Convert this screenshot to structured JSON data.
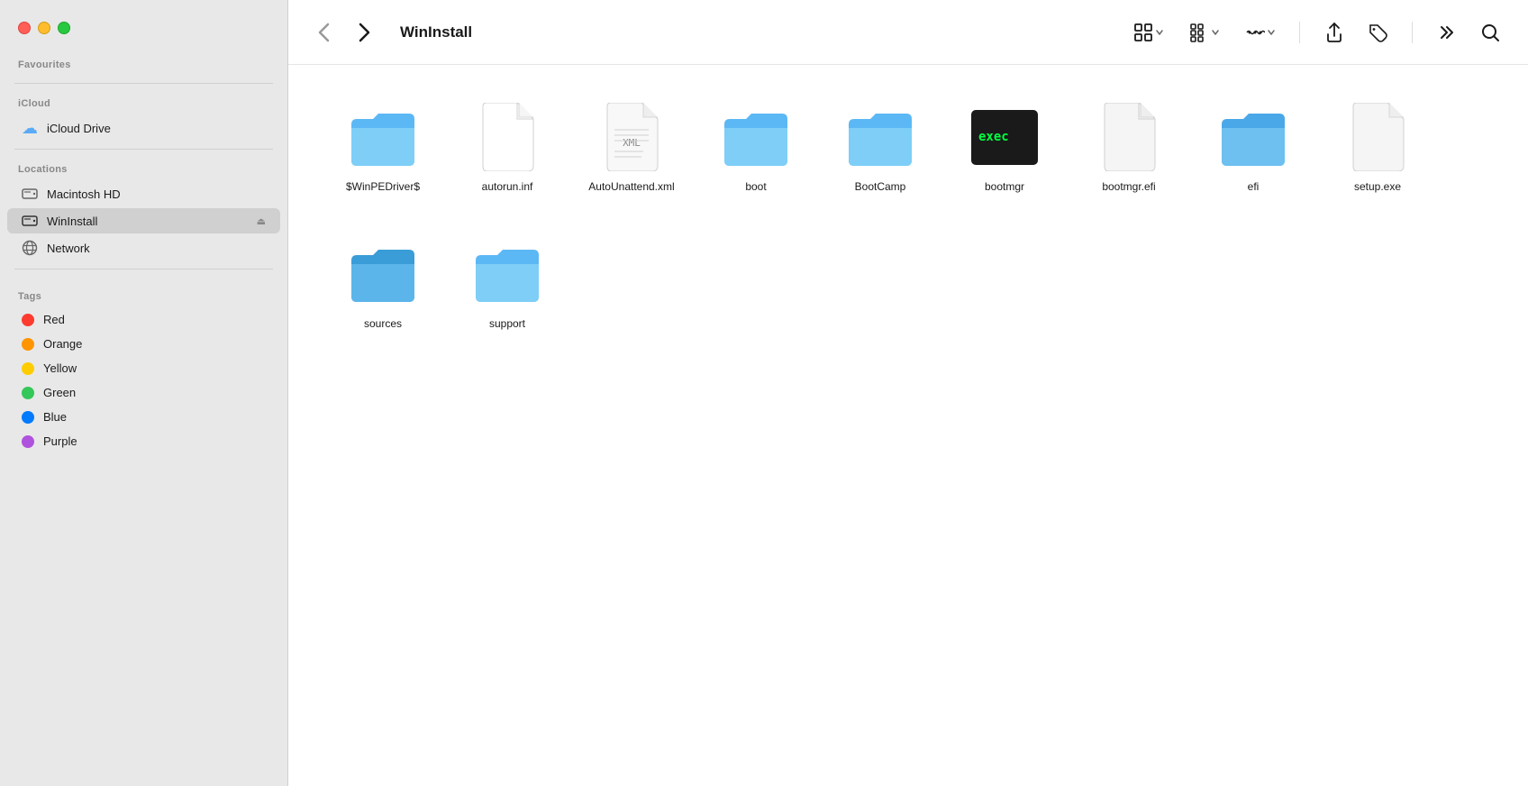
{
  "window": {
    "title": "WinInstall"
  },
  "sidebar": {
    "favourites_label": "Favourites",
    "icloud_label": "iCloud",
    "icloud_drive_label": "iCloud Drive",
    "locations_label": "Locations",
    "macintosh_hd_label": "Macintosh HD",
    "wininstall_label": "WinInstall",
    "network_label": "Network",
    "tags_label": "Tags",
    "tags": [
      {
        "name": "Red",
        "color": "#ff3b30"
      },
      {
        "name": "Orange",
        "color": "#ff9500"
      },
      {
        "name": "Yellow",
        "color": "#ffcc00"
      },
      {
        "name": "Green",
        "color": "#34c759"
      },
      {
        "name": "Blue",
        "color": "#007aff"
      },
      {
        "name": "Purple",
        "color": "#af52de"
      }
    ]
  },
  "toolbar": {
    "back_tooltip": "Back",
    "forward_tooltip": "Forward",
    "view_icon_label": "View options",
    "group_icon_label": "Group",
    "more_icon_label": "More options",
    "share_icon_label": "Share",
    "tag_icon_label": "Tag",
    "more_actions_label": "More actions",
    "search_label": "Search"
  },
  "files": [
    {
      "name": "$WinPEDriver$",
      "type": "folder"
    },
    {
      "name": "autorun.inf",
      "type": "inf"
    },
    {
      "name": "AutoUnattend.xml",
      "type": "xml"
    },
    {
      "name": "boot",
      "type": "folder"
    },
    {
      "name": "BootCamp",
      "type": "folder"
    },
    {
      "name": "bootmgr",
      "type": "exec"
    },
    {
      "name": "bootmgr.efi",
      "type": "efi"
    },
    {
      "name": "efi",
      "type": "folder-open"
    },
    {
      "name": "setup.exe",
      "type": "setup"
    },
    {
      "name": "sources",
      "type": "folder-dark"
    },
    {
      "name": "support",
      "type": "folder"
    }
  ]
}
